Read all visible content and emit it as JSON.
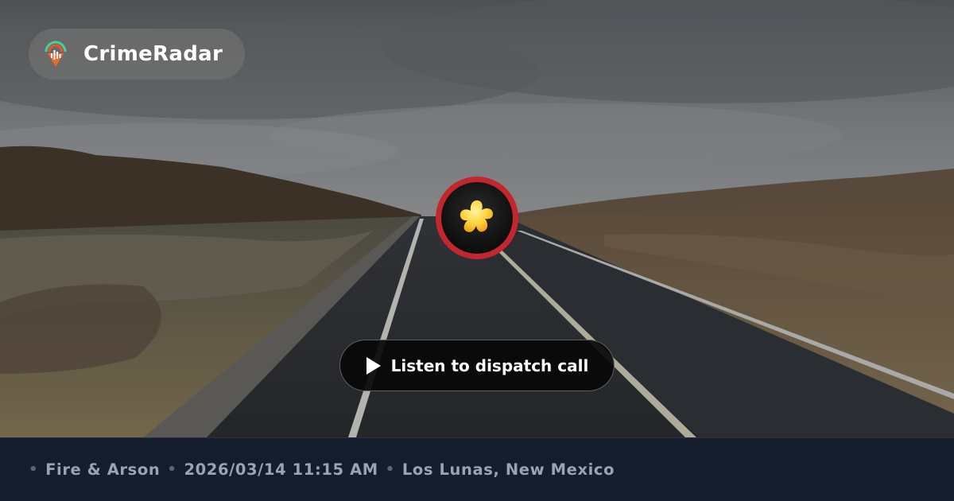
{
  "brand": {
    "name": "CrimeRadar",
    "icon": "radar-pin-icon"
  },
  "incident": {
    "category": "Fire & Arson",
    "category_icon": "puzzle-piece-icon",
    "datetime": "2026/03/14 11:15 AM",
    "location": "Los Lunas, New Mexico",
    "separator": "•"
  },
  "action": {
    "listen_label": "Listen to dispatch call",
    "icon": "play-icon"
  },
  "colors": {
    "badge_ring": "#c4262e",
    "footer_bg": "#151c2c",
    "meta_text": "#9aa3b3",
    "button_bg": "#080808"
  }
}
